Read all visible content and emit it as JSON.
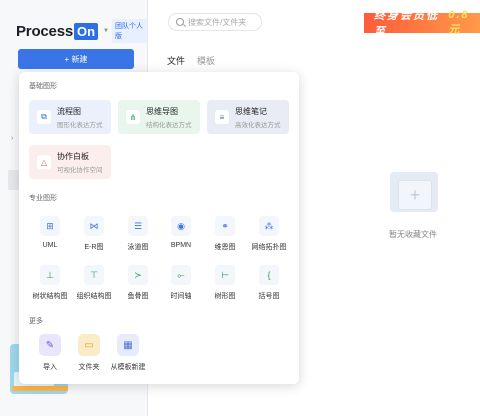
{
  "logo": {
    "text": "Process",
    "box": "On"
  },
  "team_badge": "团队个人版",
  "new_button": "+ 新建",
  "search": {
    "placeholder": "搜索文件/文件夹"
  },
  "vip": {
    "prefix": "终身会员低至",
    "price": "0.8元"
  },
  "tabs": [
    "文件",
    "模板"
  ],
  "empty_text": "暂无收藏文件",
  "menu": {
    "basic_title": "基础图形",
    "basic": [
      {
        "title": "流程图",
        "sub": "图形化表达方式",
        "bg": "#eaf1fd",
        "icon": "flowchart-icon",
        "color": "#2f6fe4"
      },
      {
        "title": "思维导图",
        "sub": "结构化表达方式",
        "bg": "#e8f6ee",
        "icon": "mindmap-icon",
        "color": "#27a35f"
      },
      {
        "title": "思维笔记",
        "sub": "高效化表达方式",
        "bg": "#e9ecf4",
        "icon": "note-icon",
        "color": "#5a6785"
      },
      {
        "title": "协作白板",
        "sub": "可视化协作空间",
        "bg": "#fdeeee",
        "icon": "whiteboard-icon",
        "color": "#e24a4a"
      }
    ],
    "pro_title": "专业图形",
    "pro": [
      {
        "label": "UML",
        "icon": "uml-icon"
      },
      {
        "label": "E-R图",
        "icon": "er-icon"
      },
      {
        "label": "泳道图",
        "icon": "swimlane-icon"
      },
      {
        "label": "BPMN",
        "icon": "bpmn-icon"
      },
      {
        "label": "维恩图",
        "icon": "venn-icon"
      },
      {
        "label": "网络拓扑图",
        "icon": "network-icon"
      },
      {
        "label": "树状结构图",
        "icon": "tree-icon"
      },
      {
        "label": "组织结构图",
        "icon": "org-icon"
      },
      {
        "label": "鱼骨图",
        "icon": "fishbone-icon"
      },
      {
        "label": "时间轴",
        "icon": "timeline-icon"
      },
      {
        "label": "树形图",
        "icon": "treemap-icon"
      },
      {
        "label": "括号图",
        "icon": "bracket-icon"
      }
    ],
    "more_title": "更多",
    "more": [
      {
        "label": "导入",
        "icon": "import-icon",
        "bg": "#e9e6fb",
        "color": "#6b57d6"
      },
      {
        "label": "文件夹",
        "icon": "folder-icon",
        "bg": "#fbecc9",
        "color": "#e2a21c"
      },
      {
        "label": "从模板新建",
        "icon": "template-icon",
        "bg": "#e6ecfb",
        "color": "#4e6fd6"
      }
    ]
  }
}
